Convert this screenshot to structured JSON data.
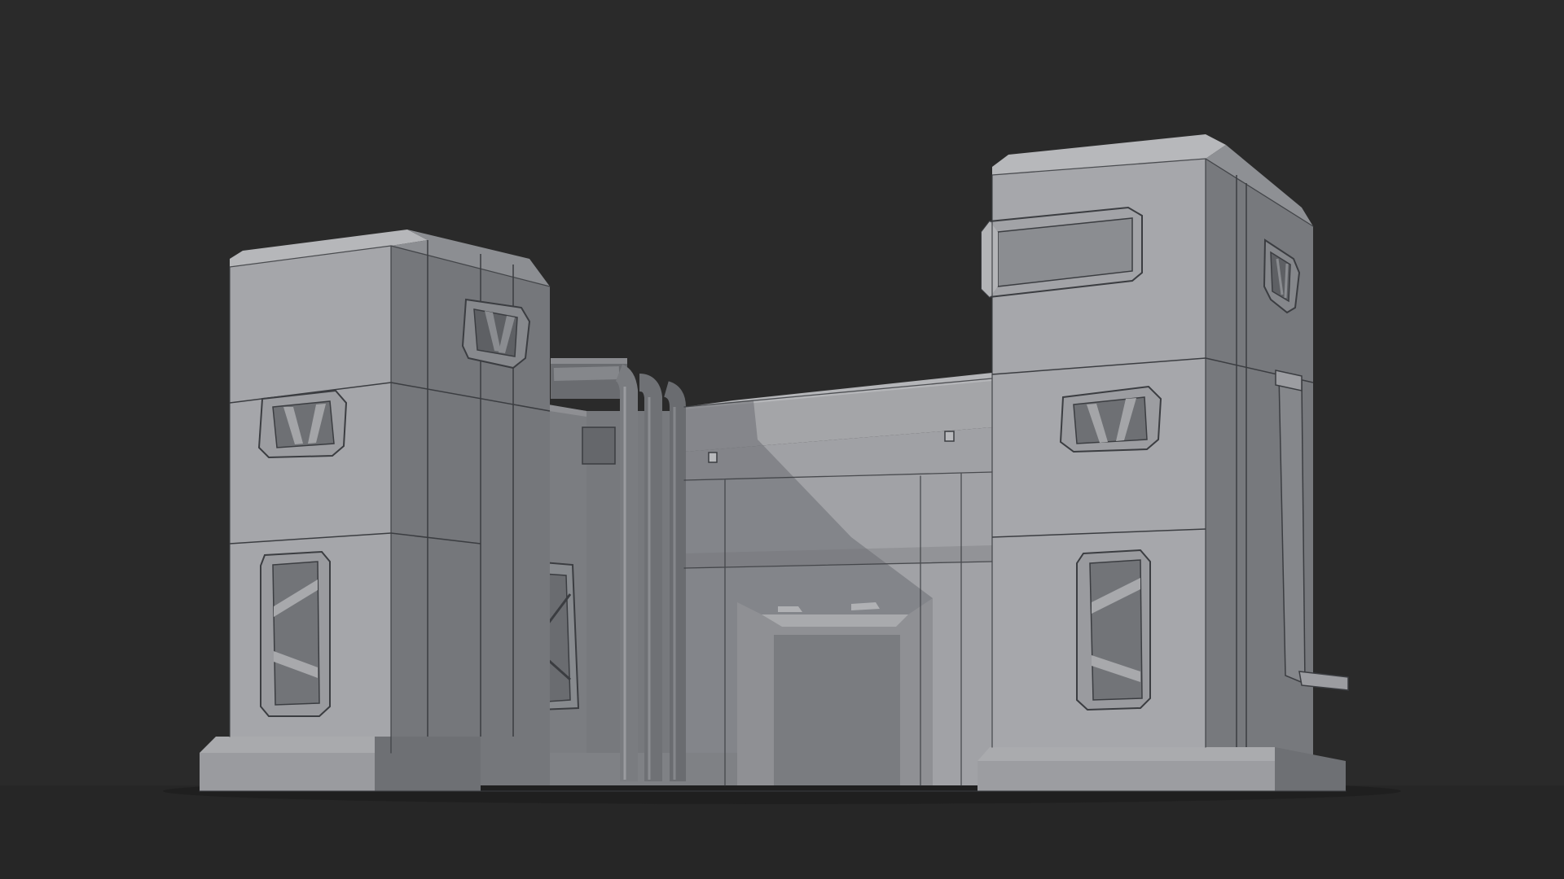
{
  "scene": {
    "colors": {
      "background": "#2a2a2a",
      "ground": "#252525",
      "wall_lit": "#a4a5a8",
      "wall_mid": "#909195",
      "wall_shade": "#707276",
      "wall_dark": "#5c5e62",
      "roof": "#b3b4b7",
      "wireframe": "#3b3d41",
      "panel_frame": "#c6c7ca",
      "panel_inner": "#7e8084"
    },
    "shadow_opacity": 0.55,
    "wire_opacity": 0.85
  }
}
